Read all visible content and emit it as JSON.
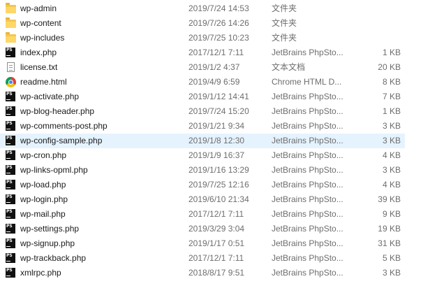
{
  "files": [
    {
      "name": "wp-admin",
      "date": "2019/7/24 14:53",
      "type": "文件夹",
      "size": "",
      "icon": "folder-icon"
    },
    {
      "name": "wp-content",
      "date": "2019/7/26 14:26",
      "type": "文件夹",
      "size": "",
      "icon": "folder-icon"
    },
    {
      "name": "wp-includes",
      "date": "2019/7/25 10:23",
      "type": "文件夹",
      "size": "",
      "icon": "folder-icon"
    },
    {
      "name": "index.php",
      "date": "2017/12/1 7:11",
      "type": "JetBrains PhpSto...",
      "size": "1 KB",
      "icon": "phpstorm-icon"
    },
    {
      "name": "license.txt",
      "date": "2019/1/2 4:37",
      "type": "文本文档",
      "size": "20 KB",
      "icon": "text-document-icon"
    },
    {
      "name": "readme.html",
      "date": "2019/4/9 6:59",
      "type": "Chrome HTML D...",
      "size": "8 KB",
      "icon": "chrome-icon"
    },
    {
      "name": "wp-activate.php",
      "date": "2019/1/12 14:41",
      "type": "JetBrains PhpSto...",
      "size": "7 KB",
      "icon": "phpstorm-icon"
    },
    {
      "name": "wp-blog-header.php",
      "date": "2019/7/24 15:20",
      "type": "JetBrains PhpSto...",
      "size": "1 KB",
      "icon": "phpstorm-icon"
    },
    {
      "name": "wp-comments-post.php",
      "date": "2019/1/21 9:34",
      "type": "JetBrains PhpSto...",
      "size": "3 KB",
      "icon": "phpstorm-icon"
    },
    {
      "name": "wp-config-sample.php",
      "date": "2019/1/8 12:30",
      "type": "JetBrains PhpSto...",
      "size": "3 KB",
      "icon": "phpstorm-icon",
      "selected": true
    },
    {
      "name": "wp-cron.php",
      "date": "2019/1/9 16:37",
      "type": "JetBrains PhpSto...",
      "size": "4 KB",
      "icon": "phpstorm-icon"
    },
    {
      "name": "wp-links-opml.php",
      "date": "2019/1/16 13:29",
      "type": "JetBrains PhpSto...",
      "size": "3 KB",
      "icon": "phpstorm-icon"
    },
    {
      "name": "wp-load.php",
      "date": "2019/7/25 12:16",
      "type": "JetBrains PhpSto...",
      "size": "4 KB",
      "icon": "phpstorm-icon"
    },
    {
      "name": "wp-login.php",
      "date": "2019/6/10 21:34",
      "type": "JetBrains PhpSto...",
      "size": "39 KB",
      "icon": "phpstorm-icon"
    },
    {
      "name": "wp-mail.php",
      "date": "2017/12/1 7:11",
      "type": "JetBrains PhpSto...",
      "size": "9 KB",
      "icon": "phpstorm-icon"
    },
    {
      "name": "wp-settings.php",
      "date": "2019/3/29 3:04",
      "type": "JetBrains PhpSto...",
      "size": "19 KB",
      "icon": "phpstorm-icon"
    },
    {
      "name": "wp-signup.php",
      "date": "2019/1/17 0:51",
      "type": "JetBrains PhpSto...",
      "size": "31 KB",
      "icon": "phpstorm-icon"
    },
    {
      "name": "wp-trackback.php",
      "date": "2017/12/1 7:11",
      "type": "JetBrains PhpSto...",
      "size": "5 KB",
      "icon": "phpstorm-icon"
    },
    {
      "name": "xmlrpc.php",
      "date": "2018/8/17 9:51",
      "type": "JetBrains PhpSto...",
      "size": "3 KB",
      "icon": "phpstorm-icon"
    }
  ]
}
